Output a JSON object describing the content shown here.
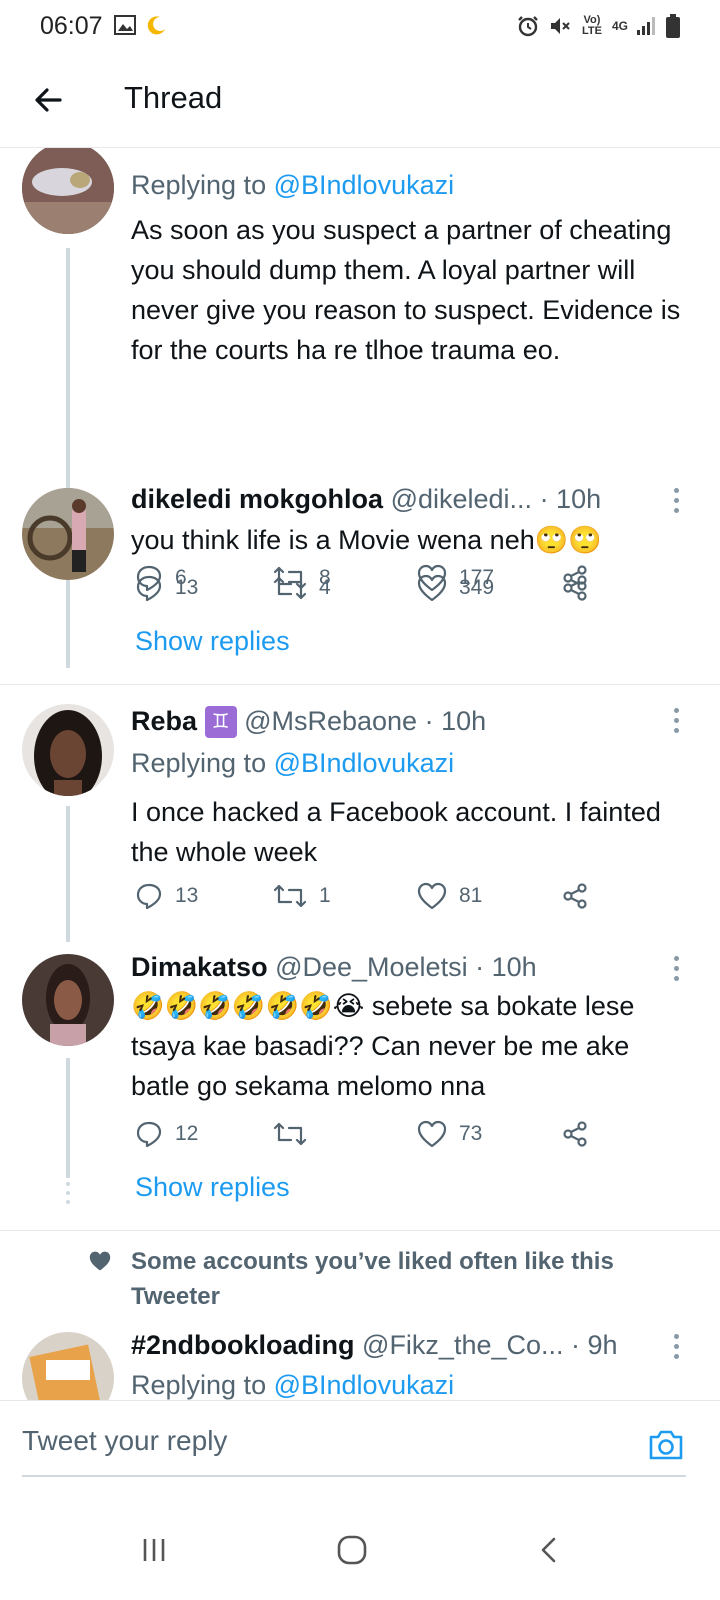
{
  "status_bar": {
    "time": "06:07",
    "network": "4G",
    "volte": "Vo) LTE"
  },
  "header": {
    "title": "Thread"
  },
  "tweets": [
    {
      "reply_to_label": "Replying to",
      "reply_to_mention": "@BIndlovukazi",
      "text": "As soon as you suspect a partner of cheating you should dump them. A loyal partner will never give you reason to suspect. Evidence is for the courts ha re tlhoe trauma eo.",
      "replies": "6",
      "retweets": "8",
      "likes": "177"
    },
    {
      "name": "dikeledi mokgohloa",
      "handle": "@dikeledi...",
      "time": "· 10h",
      "text": "you think life is a Movie wena neh🙄🙄",
      "replies": "13",
      "retweets": "4",
      "likes": "349",
      "show_replies": "Show replies"
    },
    {
      "name": "Reba",
      "badge": "♊",
      "handle": "@MsRebaone",
      "time": "· 10h",
      "reply_to_label": "Replying to",
      "reply_to_mention": "@BIndlovukazi",
      "text": "I once hacked a Facebook account. I fainted the whole week",
      "replies": "13",
      "retweets": "1",
      "likes": "81"
    },
    {
      "name": "Dimakatso",
      "handle": "@Dee_Moeletsi",
      "time": "· 10h",
      "text": "🤣🤣🤣🤣🤣🤣😭 sebete sa bokate lese tsaya kae basadi?? Can never be me ake batle go sekama melomo nna",
      "replies": "12",
      "retweets": "",
      "likes": "73",
      "show_replies": "Show replies"
    },
    {
      "liked_note": "Some accounts you’ve liked often like this Tweeter",
      "name": "#2ndbookloading",
      "handle": "@Fikz_the_Co...",
      "time": "· 9h",
      "reply_to_label": "Replying to",
      "reply_to_mention": "@BIndlovukazi"
    }
  ],
  "reply_bar": {
    "placeholder": "Tweet your reply"
  },
  "colors": {
    "accent": "#1d9bf0",
    "text": "#0f1419",
    "muted": "#536471",
    "divider": "#e6e9ec",
    "badge": "#9b6bd6"
  },
  "icons": [
    "back-arrow-icon",
    "image-icon",
    "night-mode-icon",
    "alarm-icon",
    "mute-icon",
    "signal-icon",
    "battery-icon",
    "reply-icon",
    "retweet-icon",
    "like-icon",
    "share-icon",
    "more-icon",
    "heart-icon",
    "camera-icon",
    "recents-icon",
    "home-icon",
    "back-icon"
  ]
}
